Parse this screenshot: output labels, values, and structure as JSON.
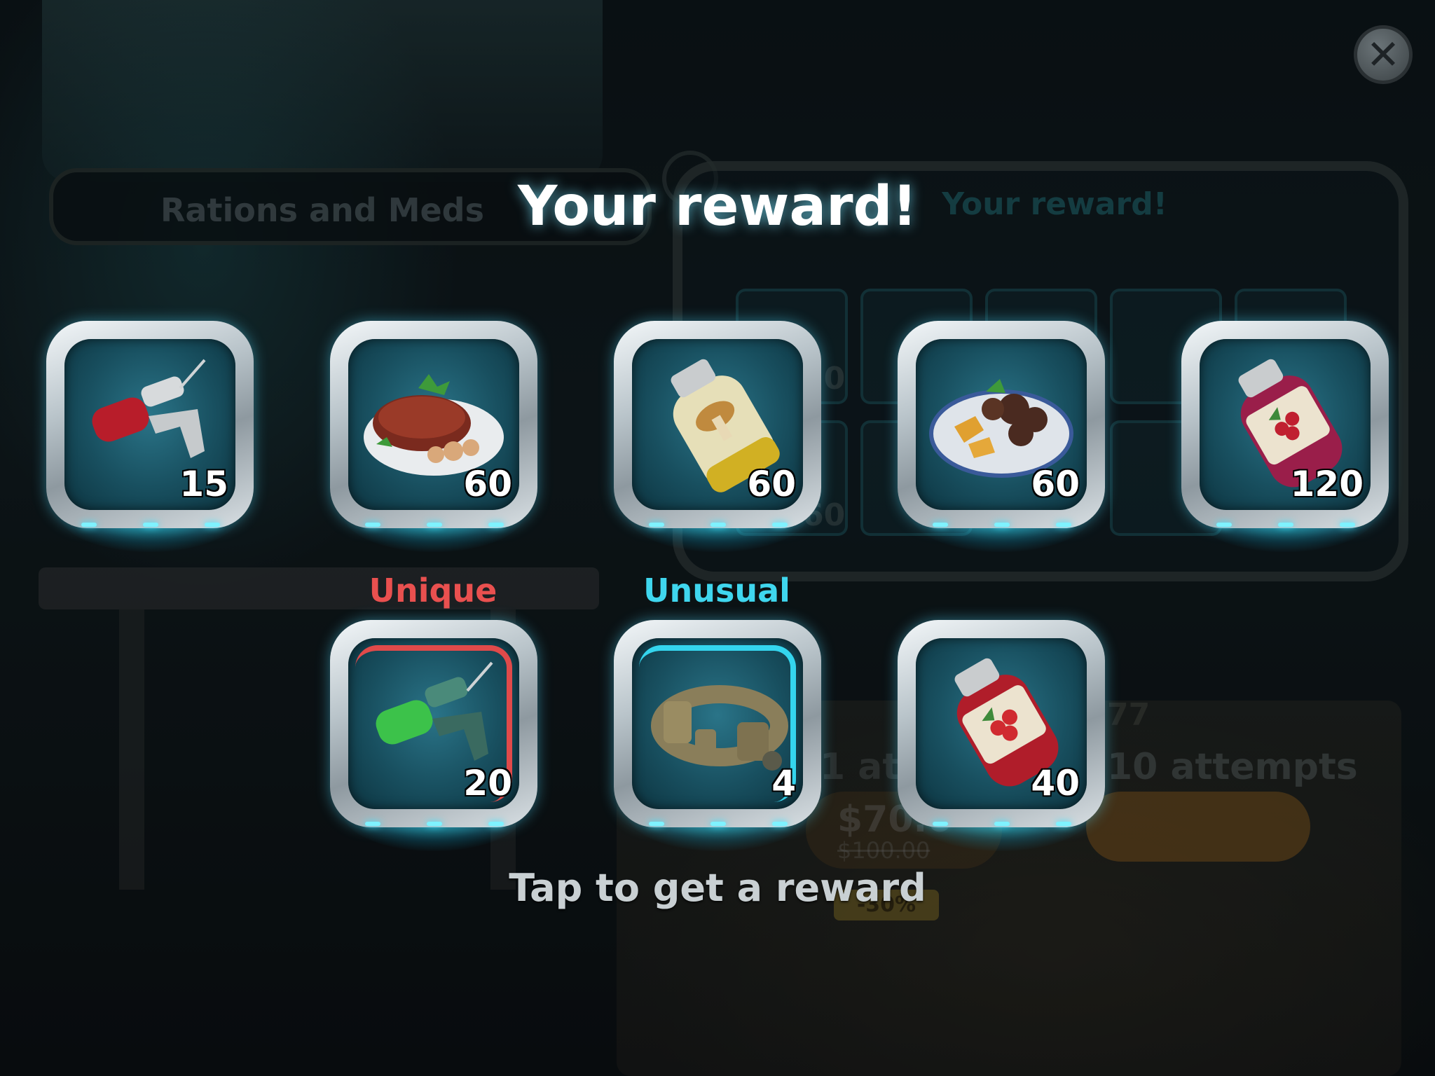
{
  "background": {
    "left_tab_label": "Rations and Meds",
    "right_tab_label": "Your reward!",
    "slot_counts": [
      "20",
      "60"
    ],
    "attempts_left_label": "1 atte",
    "attempts_right_label": "10 attempts",
    "count_label": "77",
    "price": "$70.0",
    "old_price": "$100.00",
    "discount": "-30%"
  },
  "header": {
    "title": "Your reward!",
    "close_icon": "close-icon"
  },
  "rewards_row1": [
    {
      "item": "red-syringe-injector",
      "qty": "15"
    },
    {
      "item": "steak-with-mushrooms",
      "qty": "60"
    },
    {
      "item": "mushroom-jar",
      "qty": "60"
    },
    {
      "item": "meat-with-potatoes",
      "qty": "60"
    },
    {
      "item": "berry-jar",
      "qty": "120"
    }
  ],
  "rewards_row2": [
    {
      "item": "green-syringe-injector",
      "qty": "20",
      "rarity": "Unique",
      "rarity_color": "#e9504f"
    },
    {
      "item": "tactical-belt",
      "qty": "4",
      "rarity": "Unusual",
      "rarity_color": "#3fd6ee"
    },
    {
      "item": "red-berry-jar",
      "qty": "40"
    }
  ],
  "footer": {
    "hint": "Tap to get a reward"
  }
}
